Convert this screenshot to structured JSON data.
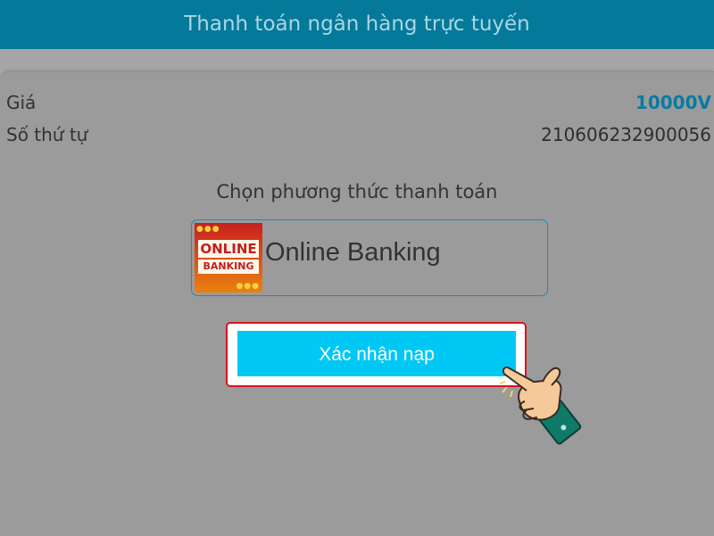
{
  "header": {
    "title": "Thanh toán ngân hàng trực tuyến"
  },
  "order": {
    "price_label": "Giá",
    "price_value": "10000V",
    "order_number_label": "Số thứ tự",
    "order_number_value": "210606232900056"
  },
  "payment": {
    "section_title": "Chọn phương thức thanh toán",
    "method": {
      "logo_line1": "ONLINE",
      "logo_line2": "BANKING",
      "name": "Online Banking"
    }
  },
  "actions": {
    "confirm_label": "Xác nhận nạp"
  },
  "colors": {
    "header_bg": "#05799a",
    "price_accent": "#0a7aa3",
    "button_bg": "#00c8f4",
    "highlight_border": "#d8141e"
  },
  "icons": {
    "pointer": "pointing-hand-icon"
  }
}
